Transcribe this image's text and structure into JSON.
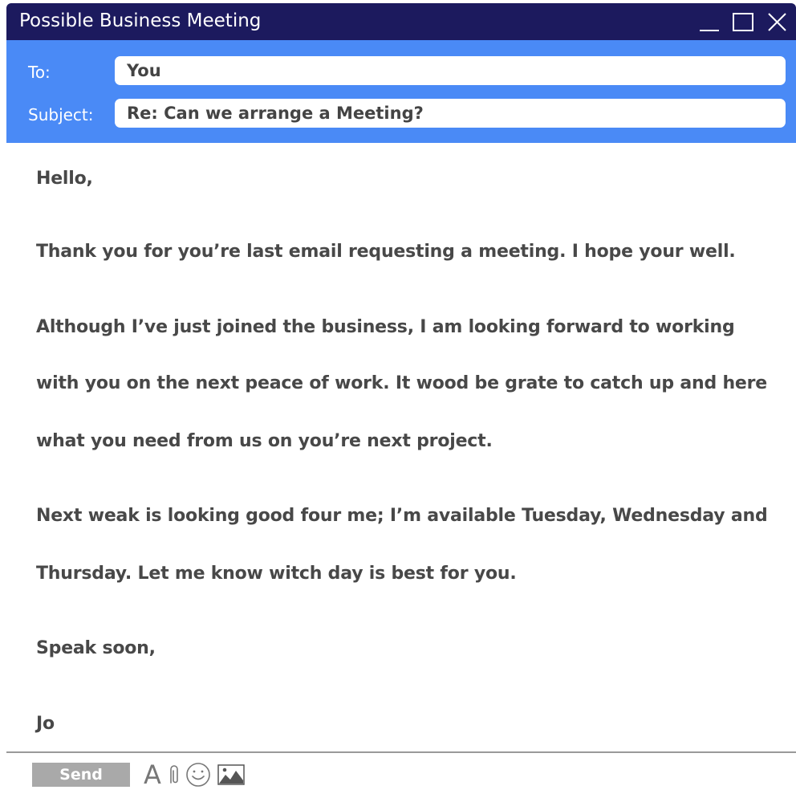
{
  "window": {
    "title": "Possible Business Meeting"
  },
  "header": {
    "to_label": "To:",
    "to_value": "You",
    "subject_label": "Subject:",
    "subject_value": "Re: Can we arrange a Meeting?"
  },
  "body": {
    "lines": [
      "Hello,",
      "Thank you for you’re last email requesting a meeting.  I hope your well.",
      "Although I’ve just joined the business, I am looking forward to working",
      "with you on the next peace of work.  It wood be grate to catch up and here",
      "what you need from us on you’re next project.",
      "Next weak is looking good four me; I’m available Tuesday, Wednesday and",
      "Thursday.  Let me know witch day is best for you.",
      "Speak soon,",
      "Jo"
    ]
  },
  "toolbar": {
    "send_label": "Send",
    "font_glyph": "A",
    "icons": [
      "font-format-icon",
      "paperclip-icon",
      "smiley-icon",
      "image-icon"
    ]
  },
  "colors": {
    "titlebar": "#1c1a5e",
    "header": "#4a8af6",
    "body_text": "#484848",
    "send_button": "#a9a9a9"
  }
}
